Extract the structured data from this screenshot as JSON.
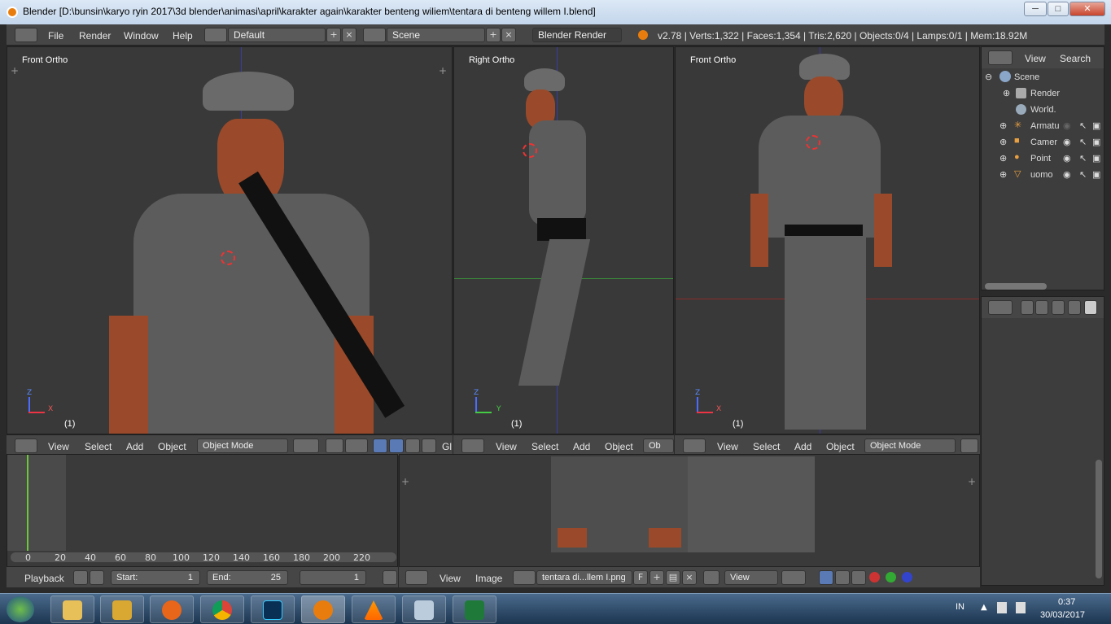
{
  "window": {
    "title": "Blender [D:\\bunsin\\karyo ryin 2017\\3d blender\\animasi\\april\\karakter again\\karakter benteng wiliem\\tentara di benteng willem I.blend]",
    "min": "─",
    "max": "□",
    "close": "✕"
  },
  "info": {
    "menus": [
      "File",
      "Render",
      "Window",
      "Help"
    ],
    "layout": "Default",
    "scene": "Scene",
    "engine": "Blender Render",
    "stats": "v2.78 | Verts:1,322 | Faces:1,354 | Tris:2,620 | Objects:0/4 | Lamps:0/1 | Mem:18.92M"
  },
  "viewports": [
    {
      "label": "Front Ortho",
      "frame": "(1)",
      "axis_a": "Z",
      "axis_b": "X"
    },
    {
      "label": "Right Ortho",
      "frame": "(1)",
      "axis_a": "Z",
      "axis_b": "Y"
    },
    {
      "label": "Front Ortho",
      "frame": "(1)",
      "axis_a": "Z",
      "axis_b": "X"
    }
  ],
  "view_header": {
    "view": "View",
    "select": "Select",
    "add": "Add",
    "object": "Object",
    "mode": "Object Mode",
    "mode_short": "Ob",
    "gl": "Gl"
  },
  "outliner": {
    "view": "View",
    "search": "Search",
    "items": [
      {
        "label": "Scene"
      },
      {
        "label": "Render"
      },
      {
        "label": "World."
      },
      {
        "label": "Armatu"
      },
      {
        "label": "Camer"
      },
      {
        "label": "Point"
      },
      {
        "label": "uomo"
      }
    ]
  },
  "timeline": {
    "ticks": [
      "0",
      "20",
      "40",
      "60",
      "80",
      "100",
      "120",
      "140",
      "160",
      "180",
      "200",
      "220"
    ],
    "playback": "Playback",
    "start_label": "Start:",
    "start": "1",
    "end_label": "End:",
    "end": "25",
    "current": "1"
  },
  "image_editor": {
    "view": "View",
    "image": "Image",
    "image_name": "tentara di...llem I.png",
    "f": "F",
    "view2": "View"
  },
  "taskbar": {
    "lang": "IN",
    "time": "0:37",
    "date": "30/03/2017"
  },
  "colors": {
    "panel": "#464646",
    "viewport": "#393939",
    "skin": "#9a4a2a",
    "shirt": "#5c5c5c",
    "blender_orange": "#e87d0d"
  }
}
